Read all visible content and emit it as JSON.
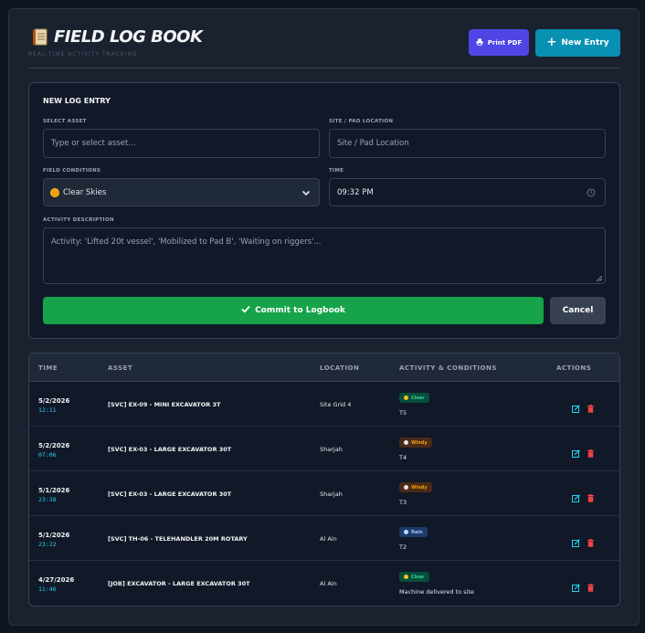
{
  "header": {
    "title": "FIELD LOG BOOK",
    "subtitle": "REAL-TIME ACTIVITY TRACKING",
    "print_label": "Print PDF",
    "new_entry_label": "New Entry"
  },
  "form": {
    "title": "NEW LOG ENTRY",
    "asset_label": "SELECT ASSET",
    "asset_placeholder": "Type or select asset...",
    "location_label": "SITE / PAD LOCATION",
    "location_placeholder": "Site / Pad Location",
    "conditions_label": "FIELD CONDITIONS",
    "conditions_value": "Clear Skies",
    "time_label": "TIME",
    "time_value": "09:32 PM",
    "description_label": "ACTIVITY DESCRIPTION",
    "description_placeholder": "Activity: 'Lifted 20t vessel', 'Mobilized to Pad B', 'Waiting on riggers'...",
    "commit_label": "Commit to Logbook",
    "cancel_label": "Cancel"
  },
  "table": {
    "columns": [
      "TIME",
      "ASSET",
      "LOCATION",
      "ACTIVITY & CONDITIONS",
      "ACTIONS"
    ],
    "rows": [
      {
        "date": "5/2/2026",
        "time": "12:11",
        "asset": "[SVC] EX-09 - MINI EXCAVATOR 3T",
        "location": "Site Grid 4",
        "condition": "Clear",
        "activity": "T5"
      },
      {
        "date": "5/2/2026",
        "time": "07:06",
        "asset": "[SVC] EX-03 - LARGE EXCAVATOR 30T",
        "location": "Sharjah",
        "condition": "Windy",
        "activity": "T4"
      },
      {
        "date": "5/1/2026",
        "time": "23:38",
        "asset": "[SVC] EX-03 - LARGE EXCAVATOR 30T",
        "location": "Sharjah",
        "condition": "Windy",
        "activity": "T3"
      },
      {
        "date": "5/1/2026",
        "time": "23:22",
        "asset": "[SVC] TH-06 - TELEHANDLER 20M ROTARY",
        "location": "Al Ain",
        "condition": "Rain",
        "activity": "T2"
      },
      {
        "date": "4/27/2026",
        "time": "11:46",
        "asset": "[JOB] EXCAVATOR - LARGE EXCAVATOR 30T",
        "location": "Al Ain",
        "condition": "Clear",
        "activity": "Machine delivered to site"
      }
    ]
  },
  "colors": {
    "accent_print": "#4f46e5",
    "accent_new": "#0891b2",
    "commit": "#16a34a",
    "edit_icon": "#22d3ee",
    "delete_icon": "#ef4444"
  }
}
